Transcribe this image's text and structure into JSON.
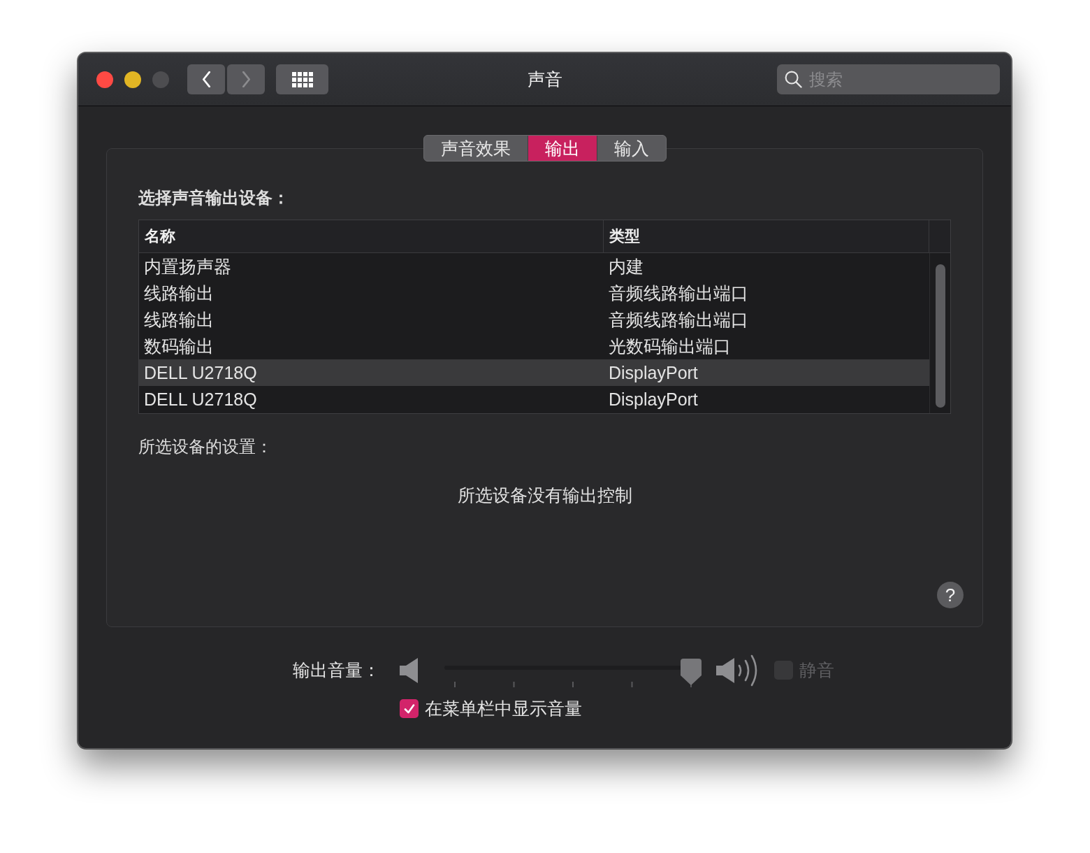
{
  "window": {
    "title": "声音"
  },
  "navigation": [
    {
      "kind": "back",
      "disabled": false
    },
    {
      "kind": "forward",
      "disabled": true
    }
  ],
  "search": {
    "placeholder": "搜索"
  },
  "tabs": [
    {
      "label": "声音效果",
      "selected": false
    },
    {
      "label": "输出",
      "selected": true
    },
    {
      "label": "输入",
      "selected": false
    }
  ],
  "output": {
    "heading": "选择声音输出设备：",
    "table": {
      "columns": [
        "名称",
        "类型"
      ],
      "rows": [
        {
          "name": "内置扬声器",
          "type": "内建",
          "selected": false
        },
        {
          "name": "线路输出",
          "type": "音频线路输出端口",
          "selected": false
        },
        {
          "name": "线路输出",
          "type": "音频线路输出端口",
          "selected": false
        },
        {
          "name": "数码输出",
          "type": "光数码输出端口",
          "selected": false
        },
        {
          "name": "DELL U2718Q",
          "type": "DisplayPort",
          "selected": true
        },
        {
          "name": "DELL U2718Q",
          "type": "DisplayPort",
          "selected": false
        }
      ]
    },
    "settings_heading": "所选设备的设置：",
    "message": "所选设备没有输出控制",
    "help": "?"
  },
  "volume": {
    "label": "输出音量：",
    "level": 1,
    "mute": {
      "label": "静音",
      "checked": false,
      "disabled": true
    }
  },
  "show_in_menu_bar": {
    "label": "在菜单栏中显示音量",
    "checked": true
  }
}
